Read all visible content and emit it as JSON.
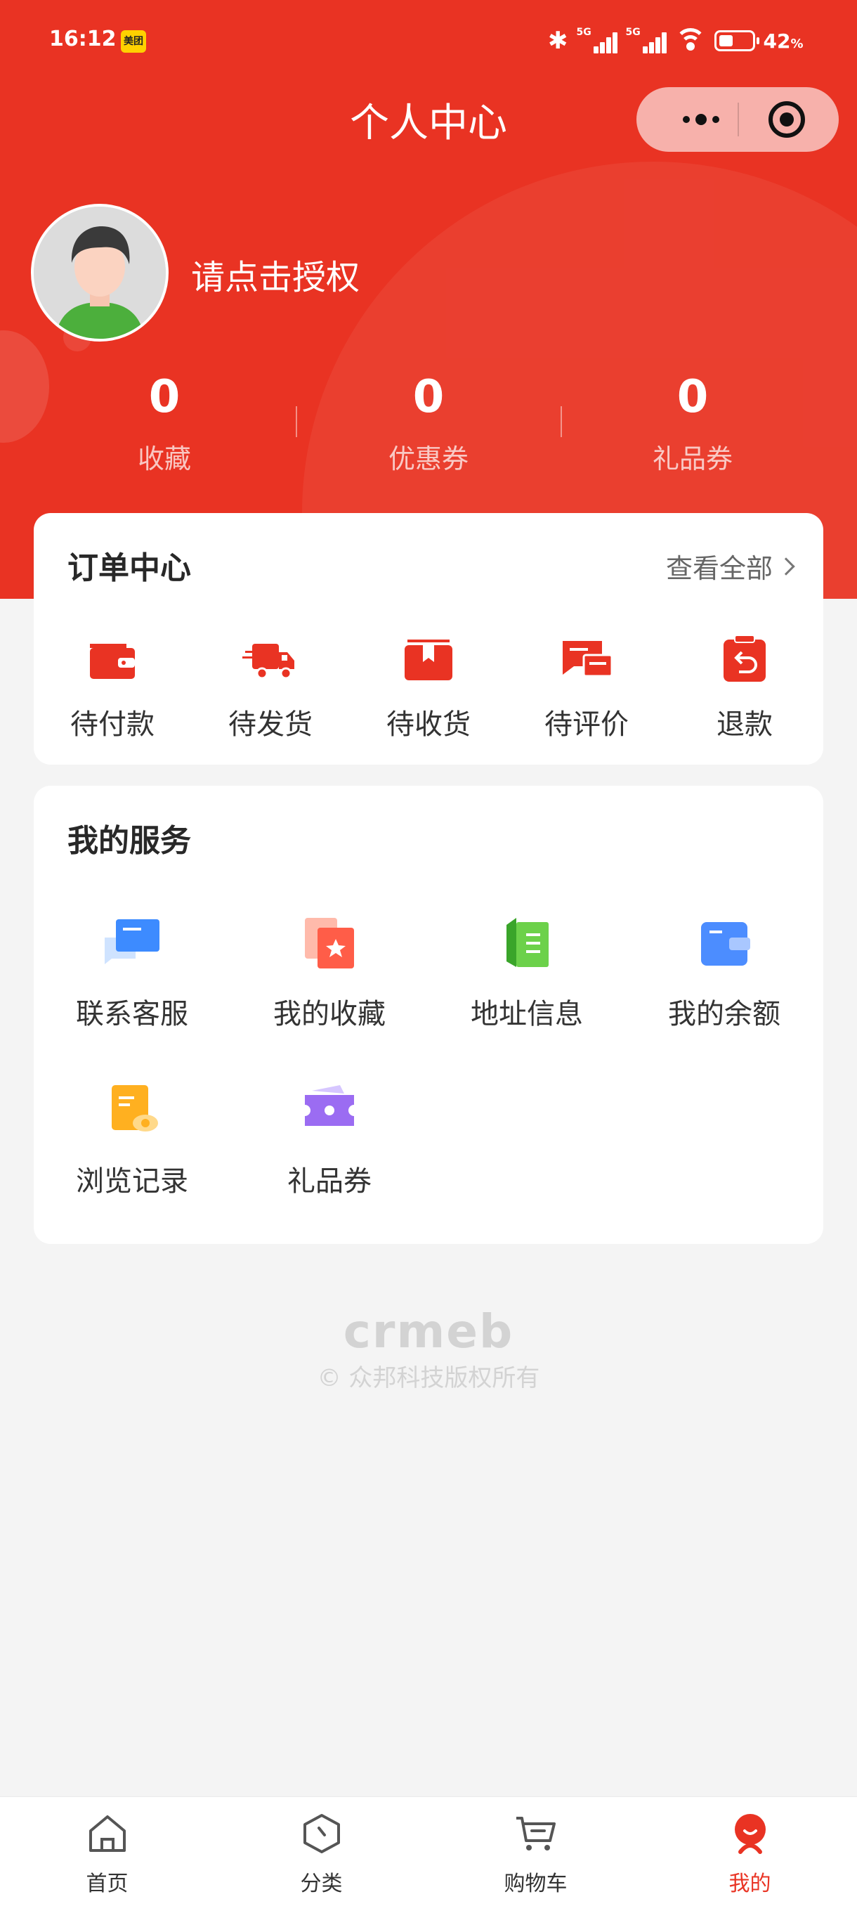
{
  "status_bar": {
    "time": "16:12",
    "app_badge": "美团",
    "network_1": "5G",
    "network_2": "5G",
    "battery": "42",
    "battery_unit": "%",
    "battery_level": 0.42
  },
  "header": {
    "title": "个人中心"
  },
  "user": {
    "auth_prompt": "请点击授权"
  },
  "stats": [
    {
      "value": "0",
      "label": "收藏"
    },
    {
      "value": "0",
      "label": "优惠券"
    },
    {
      "value": "0",
      "label": "礼品券"
    }
  ],
  "orders": {
    "title": "订单中心",
    "view_all": "查看全部",
    "items": [
      {
        "label": "待付款",
        "icon": "wallet-icon"
      },
      {
        "label": "待发货",
        "icon": "truck-icon"
      },
      {
        "label": "待收货",
        "icon": "box-icon"
      },
      {
        "label": "待评价",
        "icon": "comment-icon"
      },
      {
        "label": "退款",
        "icon": "refund-icon"
      }
    ]
  },
  "services": {
    "title": "我的服务",
    "items": [
      {
        "label": "联系客服",
        "icon": "chat-icon"
      },
      {
        "label": "我的收藏",
        "icon": "star-icon"
      },
      {
        "label": "地址信息",
        "icon": "address-book-icon"
      },
      {
        "label": "我的余额",
        "icon": "wallet-icon"
      },
      {
        "label": "浏览记录",
        "icon": "history-icon"
      },
      {
        "label": "礼品券",
        "icon": "ticket-icon"
      }
    ]
  },
  "footer": {
    "logo": "crmeb",
    "copyright": "© 众邦科技版权所有"
  },
  "tabbar": [
    {
      "label": "首页",
      "icon": "home-icon"
    },
    {
      "label": "分类",
      "icon": "category-icon"
    },
    {
      "label": "购物车",
      "icon": "cart-icon"
    },
    {
      "label": "我的",
      "icon": "profile-icon",
      "active": true
    }
  ],
  "colors": {
    "primary": "#e93323",
    "background": "#f4f4f4"
  }
}
